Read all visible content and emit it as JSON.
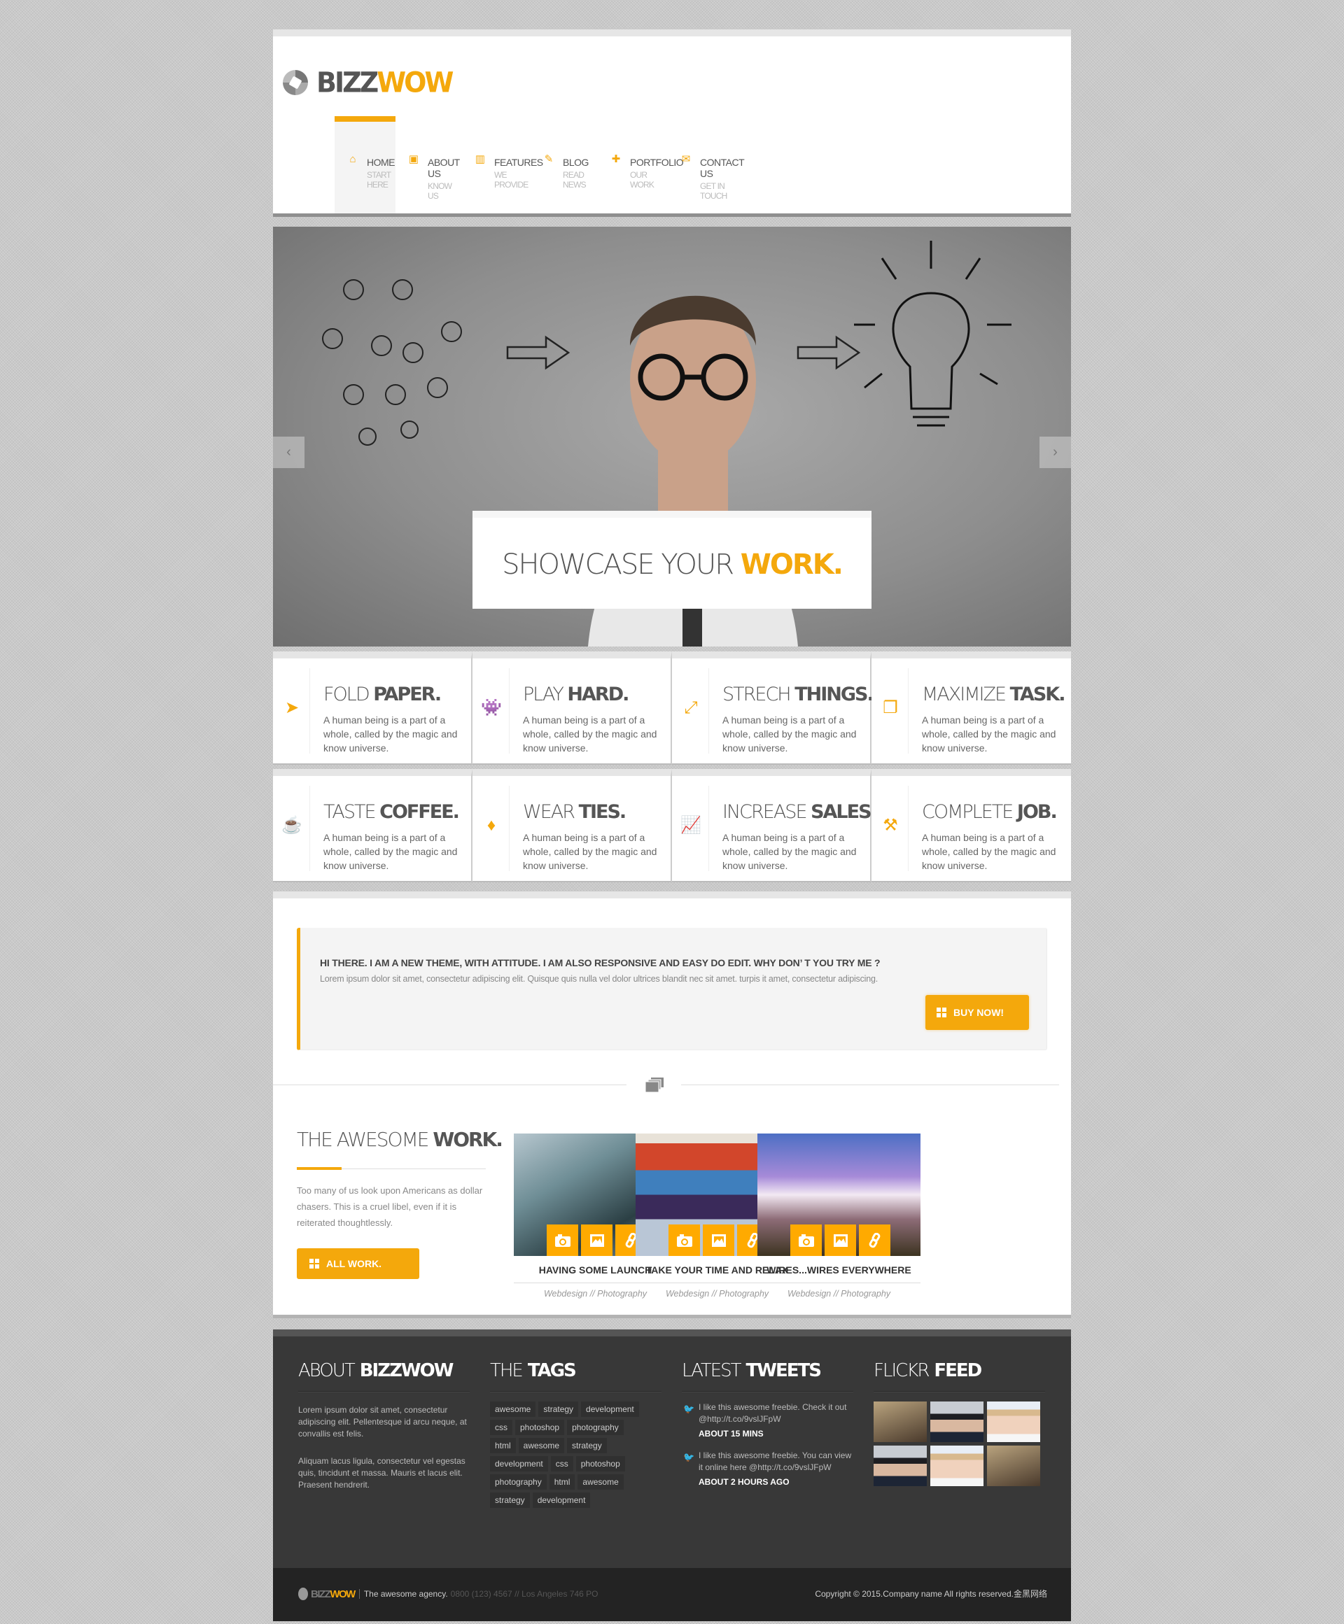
{
  "brand": {
    "name_part1": "BIZZ",
    "name_part2": "WOW",
    "accent_color": "#f4a80c"
  },
  "nav": [
    {
      "label": "HOME",
      "sub": "START HERE",
      "icon": "home-icon",
      "glyph": "⌂",
      "active": true
    },
    {
      "label": "ABOUT US",
      "sub": "KNOW US",
      "icon": "download-box-icon",
      "glyph": "▣",
      "active": false
    },
    {
      "label": "FEATURES",
      "sub": "WE PROVIDE",
      "icon": "columns-icon",
      "glyph": "▥",
      "active": false
    },
    {
      "label": "BLOG",
      "sub": "READ NEWS",
      "icon": "edit-icon",
      "glyph": "✎",
      "active": false
    },
    {
      "label": "PORTFOLIO",
      "sub": "OUR WORK",
      "icon": "briefcase-icon",
      "glyph": "✚",
      "active": false
    },
    {
      "label": "CONTACT US",
      "sub": "GET IN TOUCH",
      "icon": "envelope-icon",
      "glyph": "✉",
      "active": false
    }
  ],
  "slider": {
    "caption_light": "SHOWCASE YOUR ",
    "caption_bold": "WORK.",
    "prev": "‹",
    "next": "›"
  },
  "features": [
    {
      "light": "FOLD ",
      "bold": "PAPER.",
      "icon": "paper-plane-icon",
      "glyph": "➤",
      "desc": "A human being is a part of a whole, called by the magic and know universe."
    },
    {
      "light": "PLAY ",
      "bold": "HARD.",
      "icon": "space-invader-icon",
      "glyph": "👾",
      "desc": "A human being is a part of a whole, called by the magic and know universe."
    },
    {
      "light": "STRECH ",
      "bold": "THINGS.",
      "icon": "resize-icon",
      "glyph": "⤢",
      "desc": "A human being is a part of a whole, called by the magic and know universe."
    },
    {
      "light": "MAXIMIZE ",
      "bold": "TASK.",
      "icon": "stack-icon",
      "glyph": "❐",
      "desc": "A human being is a part of a whole, called by the magic and know universe."
    },
    {
      "light": "TASTE ",
      "bold": "COFFEE.",
      "icon": "coffee-icon",
      "glyph": "☕",
      "desc": "A human being is a part of a whole, called by the magic and know universe."
    },
    {
      "light": "WEAR ",
      "bold": "TIES.",
      "icon": "tie-icon",
      "glyph": "♦",
      "desc": "A human being is a part of a whole, called by the magic and know universe."
    },
    {
      "light": "INCREASE ",
      "bold": "SALES.",
      "icon": "chart-icon",
      "glyph": "📈",
      "desc": "A human being is a part of a whole, called by the magic and know universe."
    },
    {
      "light": "COMPLETE ",
      "bold": "JOB.",
      "icon": "gavel-icon",
      "glyph": "⚒",
      "desc": "A human being is a part of a whole, called by the magic and know universe."
    }
  ],
  "callout": {
    "heading": "HI THERE. I AM A NEW THEME, WITH ATTITUDE. I AM ALSO RESPONSIVE AND EASY DO EDIT. WHY DON’ T YOU TRY ME ?",
    "text": "Lorem ipsum dolor sit amet, consectetur adipiscing elit. Quisque quis nulla vel dolor ultrices blandit nec sit amet. turpis it amet, consectetur adipiscing.",
    "button": "BUY NOW!"
  },
  "work": {
    "title_light": "THE AWESOME ",
    "title_bold": "WORK.",
    "desc": "Too many of us look upon Americans as dollar chasers. This is a cruel libel, even if it is reiterated thoughtlessly.",
    "button": "ALL WORK.",
    "items": [
      {
        "title": "HAVING SOME LAUNCH",
        "meta": "Webdesign // Photography"
      },
      {
        "title": "TAKE YOUR TIME AND RELAX",
        "meta": "Webdesign // Photography"
      },
      {
        "title": "WIRES...WIRES EVERYWHERE",
        "meta": "Webdesign // Photography"
      }
    ]
  },
  "footer": {
    "about": {
      "title_light": "ABOUT",
      "title_bold": "BIZZWOW",
      "p1": "Lorem ipsum dolor sit amet, consectetur adipiscing elit. Pellentesque id arcu neque, at convallis est felis.",
      "p2": "Aliquam lacus ligula, consectetur vel egestas quis, tincidunt et massa. Mauris et lacus elit. Praesent hendrerit."
    },
    "tags": {
      "title_light": "THE",
      "title_bold": "TAGS",
      "items": [
        "awesome",
        "strategy",
        "development",
        "css",
        "photoshop",
        "photography",
        "html",
        "awesome",
        "strategy",
        "development",
        "css",
        "photoshop",
        "photography",
        "html",
        "awesome",
        "strategy",
        "development"
      ]
    },
    "tweets": {
      "title_light": "LATEST",
      "title_bold": "TWEETS",
      "items": [
        {
          "text": "I like this awesome freebie. Check it out @http://t.co/9vslJFpW",
          "when": "ABOUT 15 MINS"
        },
        {
          "text": "I like this awesome freebie. You can view it online here @http://t.co/9vslJFpW",
          "when": "ABOUT 2 HOURS AGO"
        }
      ]
    },
    "flickr": {
      "title_light": "FLICKR",
      "title_bold": "FEED"
    },
    "bottom": {
      "tagline": "The awesome agency.",
      "address": "0800 (123) 4567 // Los Angeles 746 PO",
      "copyright": "Copyright © 2015.Company name All rights reserved.金黑网络"
    }
  }
}
